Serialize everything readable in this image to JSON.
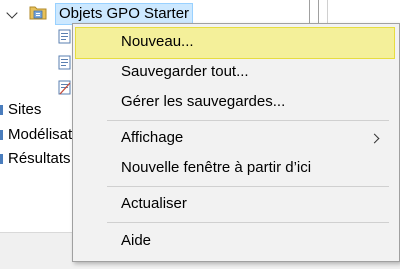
{
  "tree": {
    "gpo_starter_label": "Objets GPO Starter",
    "sites_label": "Sites",
    "modelisation_label": "Modélisat",
    "resultats_label": "Résultats"
  },
  "context_menu": {
    "items": [
      {
        "label": "Nouveau...",
        "highlighted": true
      },
      {
        "label": "Sauvegarder tout..."
      },
      {
        "label": "Gérer les sauvegardes..."
      },
      {
        "label": "Affichage",
        "has_submenu": true
      },
      {
        "label": "Nouvelle fenêtre à partir d’ici"
      },
      {
        "label": "Actualiser"
      },
      {
        "label": "Aide"
      }
    ]
  },
  "colors": {
    "selection_bg": "#cce8ff",
    "menu_highlight": "#f4f09a",
    "menu_bg": "#f2f2f2"
  }
}
